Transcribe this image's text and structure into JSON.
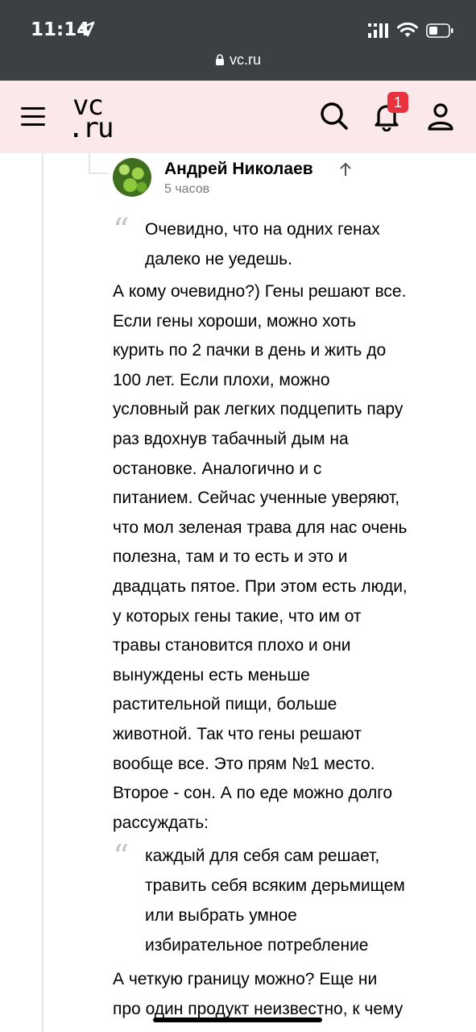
{
  "status_bar": {
    "time": "11:14",
    "url": "vc.ru",
    "background": "#3d4043"
  },
  "header": {
    "logo_line1": "vc",
    "logo_line2": ".ru",
    "notifications_count": "1",
    "background": "#fbe8ea",
    "badge_color": "#e8333f"
  },
  "comment": {
    "author": "Андрей Николаев",
    "time_ago": "5 часов",
    "quote1_lines": [
      "Очевидно, что на одних генах",
      "далеко не уедешь."
    ],
    "body1_lines": [
      "А кому очевидно?) Гены решают все.",
      "Если гены хороши, можно хоть",
      "курить по 2 пачки в день и жить до",
      "100 лет. Если плохи, можно",
      "условный рак легких подцепить пару",
      "раз вдохнув табачный дым на",
      "остановке. Аналогично и с",
      "питанием. Сейчас ученные уверяют,",
      "что мол зеленая трава для нас очень",
      "полезна, там и то есть и это и",
      "двадцать пятое. При этом есть люди,",
      "у которых гены такие, что им от",
      "травы становится плохо и они",
      "вынуждены есть меньше",
      "растительной пищи, больше",
      "животной. Так что гены решают",
      "вообще все. Это прям №1 место.",
      "Второе - сон. А по еде можно долго",
      "рассуждать:"
    ],
    "quote2_lines": [
      "каждый для себя сам решает,",
      "травить себя всяким дерьмищем",
      "или выбрать умное",
      "избирательное потребление"
    ],
    "body2_lines": [
      "А четкую границу можно? Еще ни",
      "про один продукт неизвестно, к чему"
    ]
  }
}
